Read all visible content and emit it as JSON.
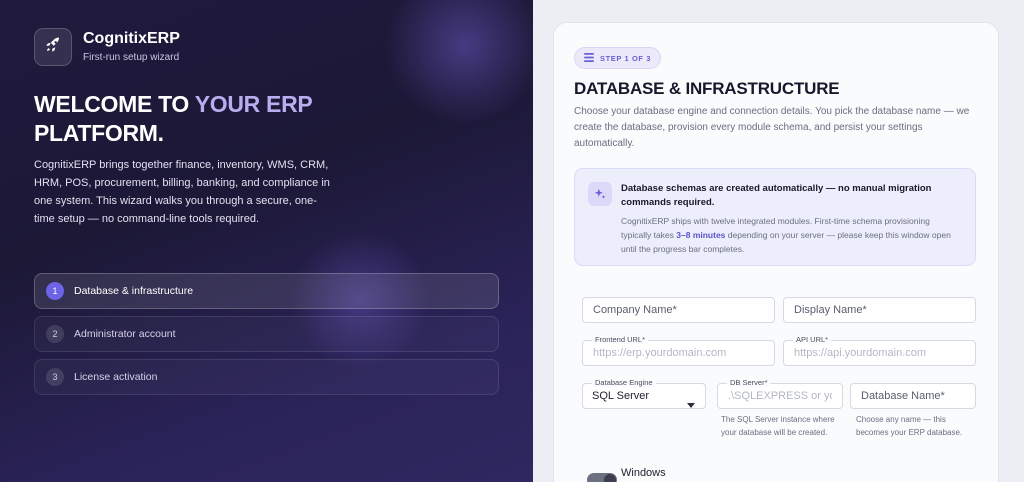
{
  "brand": {
    "name": "CognitixERP",
    "subtitle": "First-run setup wizard"
  },
  "hero": {
    "headline_part1": "WELCOME TO ",
    "headline_accent": "YOUR ERP",
    "headline_part2": "PLATFORM.",
    "intro": "CognitixERP brings together finance, inventory, WMS, CRM, HRM, POS, procurement, billing, banking, and compliance in one system. This wizard walks you through a secure, one-time setup — no command-line tools required."
  },
  "steps": [
    {
      "number": "1",
      "label": "Database & infrastructure",
      "active": true
    },
    {
      "number": "2",
      "label": "Administrator account",
      "active": false
    },
    {
      "number": "3",
      "label": "License activation",
      "active": false
    }
  ],
  "card": {
    "step_badge": "STEP 1 OF 3",
    "title": "DATABASE & INFRASTRUCTURE",
    "description": "Choose your database engine and connection details. You pick the database name — we create the database, provision every module schema, and persist your settings automatically."
  },
  "notice": {
    "title": "Database schemas are created automatically — no manual migration commands required.",
    "body_before": "CognitixERP ships with twelve integrated modules. First-time schema provisioning typically takes ",
    "body_highlight": "3–8 minutes",
    "body_after": " depending on your server — please keep this window open until the progress bar completes."
  },
  "form": {
    "company_name": {
      "placeholder": "Company Name*",
      "value": ""
    },
    "display_name": {
      "placeholder": "Display Name*",
      "value": ""
    },
    "frontend_url": {
      "label": "Frontend URL*",
      "placeholder": "https://erp.yourdomain.com",
      "value": ""
    },
    "api_url": {
      "label": "API URL*",
      "placeholder": "https://api.yourdomain.com",
      "value": ""
    },
    "db_engine": {
      "label": "Database Engine",
      "value": "SQL Server"
    },
    "db_server": {
      "label": "DB Server*",
      "placeholder": ".\\SQLEXPRESS or you",
      "value": "",
      "helper": "The SQL Server instance where your database will be created."
    },
    "db_name": {
      "placeholder": "Database Name*",
      "value": "",
      "helper": "Choose any name — this becomes your ERP database."
    },
    "windows_auth_label": "Windows"
  },
  "colors": {
    "accent": "#6c63e6",
    "left_bg": "#1c1836",
    "highlight": "#5c52d0"
  }
}
